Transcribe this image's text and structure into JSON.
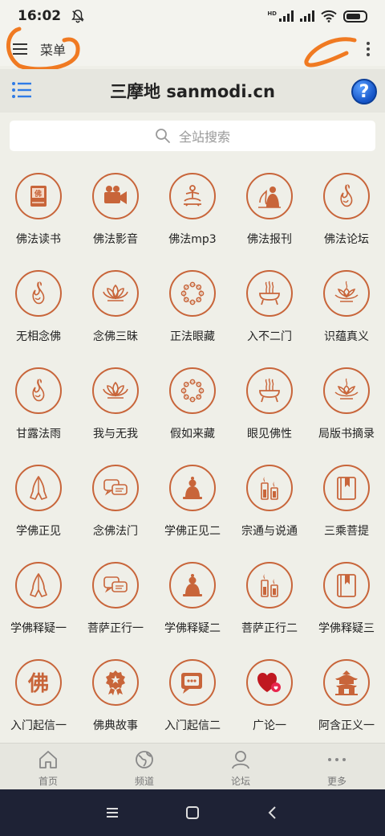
{
  "status": {
    "time": "16:02"
  },
  "menu": {
    "label": "菜单"
  },
  "header": {
    "title": "三摩地 sanmodi.cn",
    "help": "?"
  },
  "search": {
    "placeholder": "全站搜索"
  },
  "grid": [
    {
      "label": "佛法读书",
      "icon": "book-icon"
    },
    {
      "label": "佛法影音",
      "icon": "video-camera-icon"
    },
    {
      "label": "佛法mp3",
      "icon": "meditation-icon"
    },
    {
      "label": "佛法报刊",
      "icon": "monk-icon"
    },
    {
      "label": "佛法论坛",
      "icon": "flame-icon"
    },
    {
      "label": "无相念佛",
      "icon": "flame-icon"
    },
    {
      "label": "念佛三昧",
      "icon": "lotus-icon"
    },
    {
      "label": "正法眼藏",
      "icon": "beads-icon"
    },
    {
      "label": "入不二门",
      "icon": "incense-icon"
    },
    {
      "label": "识蕴真义",
      "icon": "lotus-lamp-icon"
    },
    {
      "label": "甘露法雨",
      "icon": "flame-icon"
    },
    {
      "label": "我与无我",
      "icon": "lotus-icon"
    },
    {
      "label": "假如来藏",
      "icon": "beads-icon"
    },
    {
      "label": "眼见佛性",
      "icon": "incense-icon"
    },
    {
      "label": "局版书摘录",
      "icon": "lotus-lamp-icon"
    },
    {
      "label": "学佛正见",
      "icon": "praying-hands-icon"
    },
    {
      "label": "念佛法门",
      "icon": "chat-icon"
    },
    {
      "label": "学佛正见二",
      "icon": "buddha-icon"
    },
    {
      "label": "宗通与说通",
      "icon": "candles-icon"
    },
    {
      "label": "三乘菩提",
      "icon": "bookmark-book-icon"
    },
    {
      "label": "学佛释疑一",
      "icon": "praying-hands-icon"
    },
    {
      "label": "菩萨正行一",
      "icon": "chat-icon"
    },
    {
      "label": "学佛释疑二",
      "icon": "buddha-icon"
    },
    {
      "label": "菩萨正行二",
      "icon": "candles-icon"
    },
    {
      "label": "学佛释疑三",
      "icon": "bookmark-book-icon"
    },
    {
      "label": "入门起信一",
      "icon": "fo-character-icon",
      "glyph": "佛"
    },
    {
      "label": "佛典故事",
      "icon": "award-ribbon-icon"
    },
    {
      "label": "入门起信二",
      "icon": "message-bubble-icon"
    },
    {
      "label": "广论一",
      "icon": "hearts-icon"
    },
    {
      "label": "阿含正义一",
      "icon": "temple-icon"
    }
  ],
  "bottom_nav": [
    {
      "label": "首页",
      "icon": "home-icon"
    },
    {
      "label": "频道",
      "icon": "globe-icon"
    },
    {
      "label": "论坛",
      "icon": "user-icon"
    },
    {
      "label": "更多",
      "icon": "more-dots-icon"
    }
  ],
  "colors": {
    "accent": "#c8653a",
    "background": "#efefe8"
  }
}
